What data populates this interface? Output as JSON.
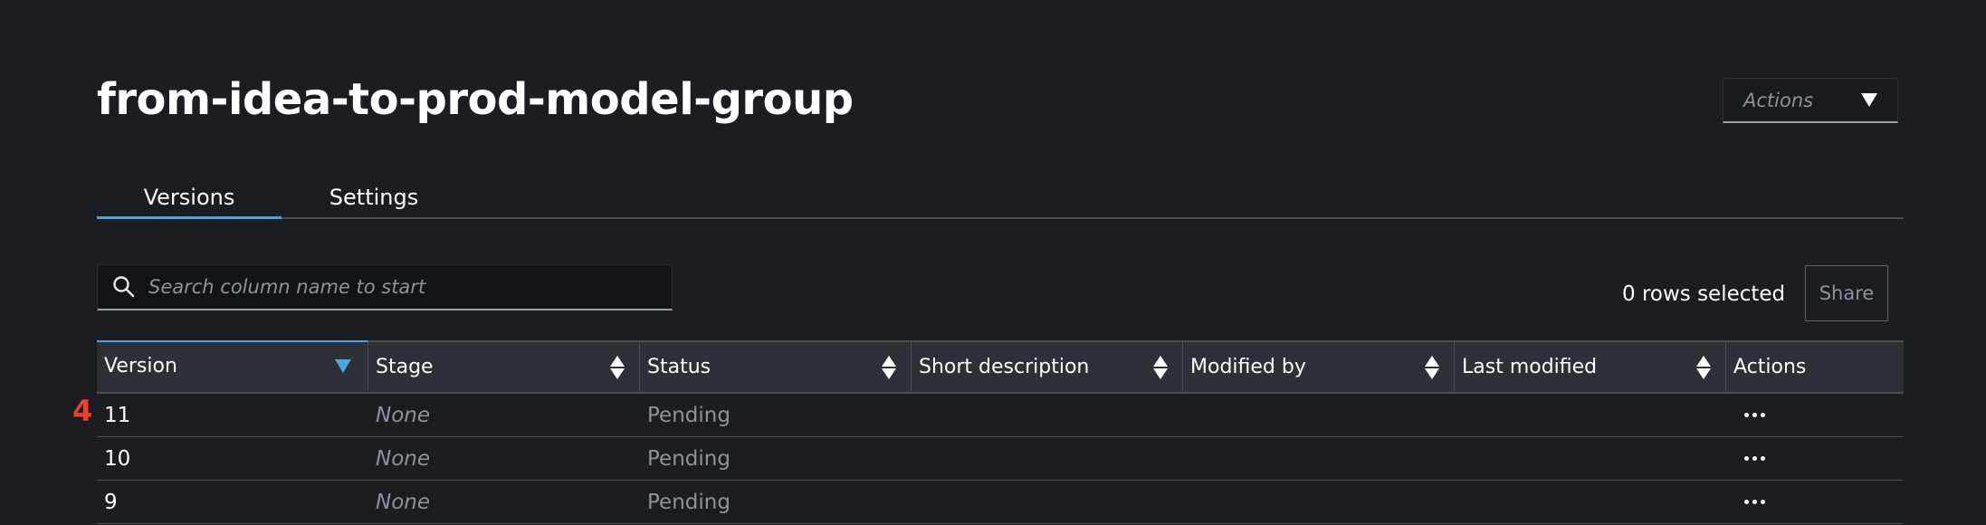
{
  "header": {
    "title": "from-idea-to-prod-model-group",
    "actions_label": "Actions"
  },
  "tabs": [
    {
      "label": "Versions",
      "active": true
    },
    {
      "label": "Settings",
      "active": false
    }
  ],
  "search": {
    "placeholder": "Search column name to start",
    "value": ""
  },
  "selection": {
    "rows_selected": "0 rows selected",
    "share_label": "Share"
  },
  "table": {
    "columns": [
      "Version",
      "Stage",
      "Status",
      "Short description",
      "Modified by",
      "Last modified",
      "Actions"
    ],
    "rows": [
      {
        "version": "11",
        "stage": "None",
        "status": "Pending",
        "short_description": "",
        "modified_by": "",
        "last_modified": ""
      },
      {
        "version": "10",
        "stage": "None",
        "status": "Pending",
        "short_description": "",
        "modified_by": "",
        "last_modified": ""
      },
      {
        "version": "9",
        "stage": "None",
        "status": "Pending",
        "short_description": "",
        "modified_by": "",
        "last_modified": ""
      }
    ]
  },
  "annotation": {
    "marker": "4"
  },
  "colors": {
    "background": "#1c1d22",
    "accent": "#4fa3df",
    "marker": "#e8412c",
    "header_bg": "#2e3038",
    "muted_text": "#8d939b"
  },
  "icons": {
    "search": "search-icon",
    "dropdown": "caret-down-icon",
    "sort": "sort-icon",
    "sorted_desc": "sort-descending-icon",
    "row_actions": "more-horizontal-icon"
  }
}
